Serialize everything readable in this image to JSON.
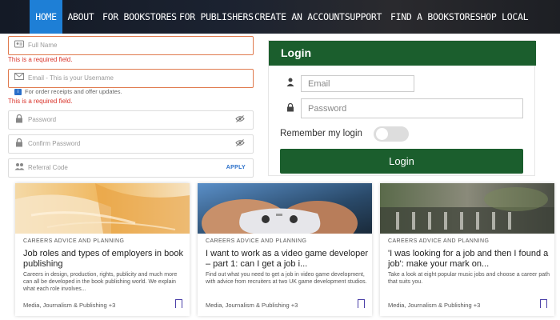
{
  "nav": {
    "items": [
      "HOME",
      "ABOUT",
      "FOR BOOKSTORES",
      "FOR PUBLISHERS",
      "CREATE AN ACCOUNT",
      "SUPPORT",
      "FIND A BOOKSTORE",
      "SHOP LOCAL"
    ],
    "active": "HOME"
  },
  "register": {
    "full_name_placeholder": "Full Name",
    "full_name_error": "This is a required field.",
    "email_placeholder": "Email - This is your Username",
    "email_info": "For order receipts and offer updates.",
    "email_error": "This is a required field.",
    "password_placeholder": "Password",
    "confirm_password_placeholder": "Confirm Password",
    "referral_placeholder": "Referral Code",
    "apply_label": "APPLY",
    "info_badge": "i"
  },
  "login": {
    "heading": "Login",
    "email_placeholder": "Email",
    "password_placeholder": "Password",
    "remember_label": "Remember my login",
    "remember_on": false,
    "button_label": "Login"
  },
  "cards": [
    {
      "category": "CAREERS ADVICE AND PLANNING",
      "title": "Job roles and types of employers in book publishing",
      "description": "Careers in design, production, rights, publicity and much more can all be developed in the book publishing world. We explain what each role involves...",
      "tags": "Media, Journalism & Publishing +3",
      "image": "books-photo"
    },
    {
      "category": "CAREERS ADVICE AND PLANNING",
      "title": "I want to work as a video game developer – part 1: can I get a job i...",
      "description": "Find out what you need to get a job in video game development, with advice from recruiters at two UK game development studios.",
      "tags": "Media, Journalism & Publishing +3",
      "image": "game-controller-photo"
    },
    {
      "category": "CAREERS ADVICE AND PLANNING",
      "title": "'I was looking for a job and then I found a job': make your mark on...",
      "description": "Take a look at eight popular music jobs and choose a career path that suits you.",
      "tags": "Media, Journalism & Publishing +3",
      "image": "music-studio-photo"
    }
  ],
  "colors": {
    "nav_active": "#1e7fd6",
    "login_green": "#1b5e2d",
    "error_red": "#d9342b",
    "bookmark": "#4a3fa8"
  }
}
